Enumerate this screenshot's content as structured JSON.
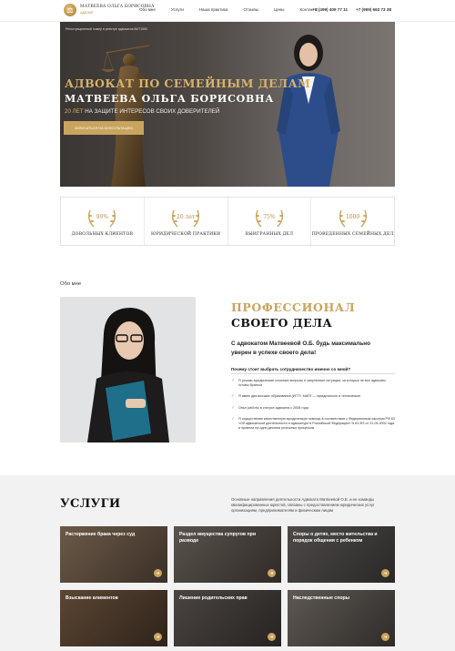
{
  "header": {
    "logo_name": "МАТВЕЕВА ОЛЬГА БОРИСОВНА",
    "logo_sub": "АДВОКАТ",
    "nav": [
      "Обо мне",
      "Услуги",
      "Наша практика",
      "Отзывы",
      "Цены",
      "Контакты"
    ],
    "phones": [
      "+7 (499) 409 77 11",
      "+7 (999) 663 73 38"
    ]
  },
  "hero": {
    "registry": "Регистрационный номер в реестре адвокатов 66/71060",
    "title": "АДВОКАТ ПО СЕМЕЙНЫМ ДЕЛАМ",
    "name": "МАТВЕЕВА ОЛЬГА БОРИСОВНА",
    "sub_gold": "20 ЛЕТ",
    "sub_rest": " НА ЗАЩИТЕ ИНТЕРЕСОВ СВОИХ ДОВЕРИТЕЛЕЙ",
    "button": "ЗАПИСАТЬСЯ НА КОНСУЛЬТАЦИЮ"
  },
  "stats": [
    {
      "value": "99%",
      "label": "ДОВОЛЬНЫХ КЛИЕНТОВ"
    },
    {
      "value": "20 лет",
      "label": "ЮРИДИЧЕСКОЙ ПРАКТИКИ"
    },
    {
      "value": "75%",
      "label": "ВЫИГРАННЫХ ДЕЛ"
    },
    {
      "value": "1000",
      "label": "ПРОВЕДЕННЫХ СЕМЕЙНЫХ ДЕЛ"
    }
  ],
  "about": {
    "tag": "Обо мне",
    "heading_gold": "ПРОФЕССИОНАЛ",
    "heading_dark": "СВОЕГО ДЕЛА",
    "lead": "С адвокатом Матвеевой О.Б. будь максимально уверен в успехе своего дела!",
    "question": "Почему стоит выбрать сотрудничество именно со мной?",
    "points": [
      "Я решаю юридические сложные вопросы и запутанные ситуации, за которые не все адвокаты готовы браться",
      "Я имею два высших образования (ИГТУ, МАГЕ — юридическое и техническое",
      "Опыт работы в статусе адвоката с 2008 года",
      "Я осуществляю качественную юридическую помощь в соответствии с Федеральным законом РФ 63 «Об адвокатской деятельности и адвокатуре в Российской Федерации» N 63-ФЗ от 31.05.2002 года и провела на одни десятки успешных процессов"
    ]
  },
  "services": {
    "title": "УСЛУГИ",
    "desc": "Основные направления деятельности Адвоката Матвеевой О.Б. и ее команды квалифицированных юристов, связаны с предоставлением юридических услуг организациям, предпринимателям и физическим лицам",
    "cards": [
      "Расторжение брака через суд",
      "Раздел имущества супругов при разводе",
      "Споры о детях, место жительства и порядок общения с ребенком",
      "Взыскание алиментов",
      "Лишение родительских прав",
      "Наследственные споры"
    ]
  }
}
